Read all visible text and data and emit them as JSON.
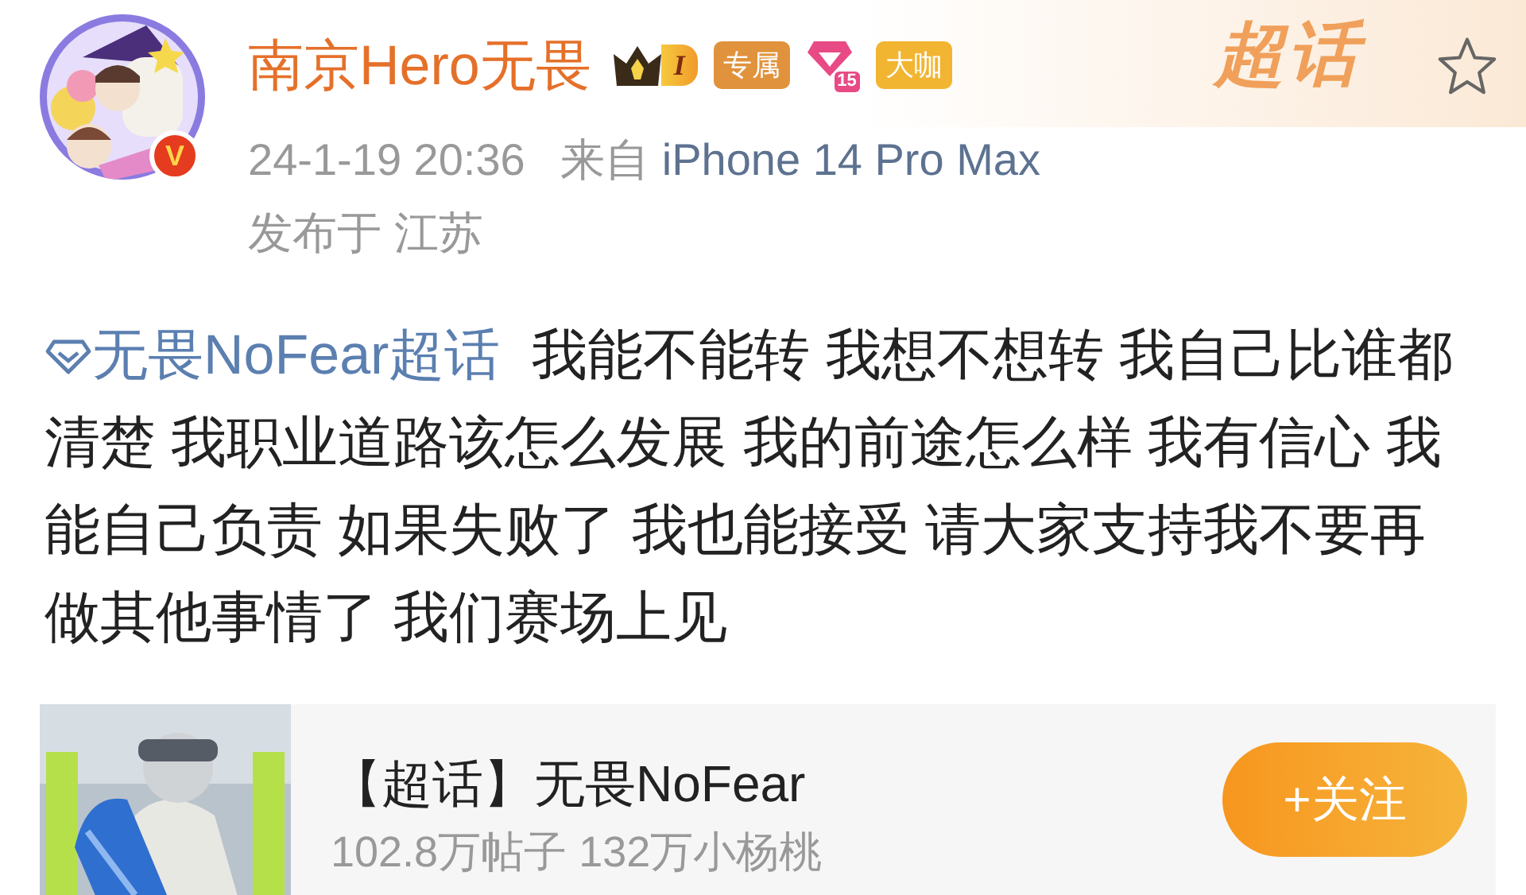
{
  "author": {
    "name": "南京Hero无畏",
    "verified_mark": "V",
    "badges": [
      {
        "kind": "crown",
        "text": "I"
      },
      {
        "kind": "tag",
        "text": "专属",
        "color": "#e0933c"
      },
      {
        "kind": "gem",
        "text": "15"
      },
      {
        "kind": "tag",
        "text": "大咖",
        "color": "#f2b531"
      }
    ]
  },
  "header": {
    "supertopic_logo": "超话",
    "favorited": false
  },
  "meta": {
    "time": "24-1-19 20:36",
    "source_prefix": "来自",
    "source": "iPhone 14 Pro Max",
    "location": "发布于 江苏"
  },
  "post": {
    "topic": "无畏NoFear超话",
    "text": "我能不能转 我想不想转 我自己比谁都清楚 我职业道路该怎么发展 我的前途怎么样 我有信心 我能自己负责 如果失败了 我也能接受 请大家支持我不要再做其他事情了 我们赛场上见"
  },
  "topic_card": {
    "title": "【超话】无畏NoFear",
    "stats": "102.8万帖子 132万小杨桃",
    "follow_button": "+关注"
  }
}
